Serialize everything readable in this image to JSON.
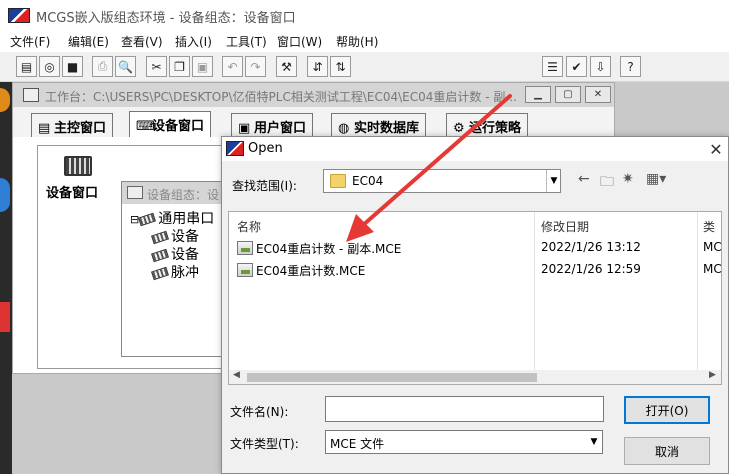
{
  "app": {
    "title": "MCGS嵌入版组态环境 - 设备组态：设备窗口",
    "menu": [
      "文件(F)",
      "编辑(E)",
      "查看(V)",
      "插入(I)",
      "工具(T)",
      "窗口(W)",
      "帮助(H)"
    ]
  },
  "workspace": {
    "title": "工作台：C:\\USERS\\PC\\DESKTOP\\亿佰特PLC相关测试工程\\EC04\\EC04重启计数 - 副...",
    "tabs": [
      {
        "label": "主控窗口",
        "icon": "main-window-icon"
      },
      {
        "label": "设备窗口",
        "icon": "device-icon"
      },
      {
        "label": "用户窗口",
        "icon": "user-window-icon"
      },
      {
        "label": "实时数据库",
        "icon": "database-icon"
      },
      {
        "label": "运行策略",
        "icon": "strategy-icon"
      }
    ],
    "device_label": "设备窗口"
  },
  "device_window": {
    "title": "设备组态：设",
    "tree": [
      "通用串口",
      "设备",
      "设备",
      "脉冲"
    ]
  },
  "dialog": {
    "title": "Open",
    "look_in_label": "查找范围(I):",
    "look_in_value": "EC04",
    "columns": [
      "名称",
      "修改日期",
      "类"
    ],
    "files": [
      {
        "name": "EC04重启计数 - 副本.MCE",
        "date": "2022/1/26 13:12",
        "type": "MC"
      },
      {
        "name": "EC04重启计数.MCE",
        "date": "2022/1/26 12:59",
        "type": "MC"
      }
    ],
    "file_name_label": "文件名(N):",
    "file_name_value": "",
    "file_type_label": "文件类型(T):",
    "file_type_value": "MCE 文件",
    "open_label": "打开(O)",
    "cancel_label": "取消"
  },
  "colors": {
    "arrow": "#e53935",
    "focus": "#0078d7"
  }
}
